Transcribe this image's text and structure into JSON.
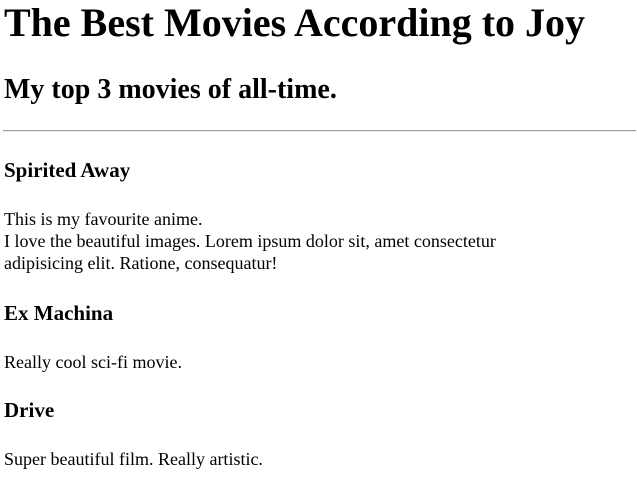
{
  "header": {
    "title": "The Best Movies According to Joy",
    "subtitle": "My top 3 movies of all-time."
  },
  "movies": [
    {
      "title": "Spirited Away",
      "lines": [
        "This is my favourite anime.",
        "I love the beautiful images. Lorem ipsum dolor sit, amet consectetur",
        "adipisicing elit. Ratione, consequatur!"
      ]
    },
    {
      "title": "Ex Machina",
      "lines": [
        "Really cool sci-fi movie."
      ]
    },
    {
      "title": "Drive",
      "lines": [
        "Super beautiful film. Really artistic."
      ]
    }
  ]
}
